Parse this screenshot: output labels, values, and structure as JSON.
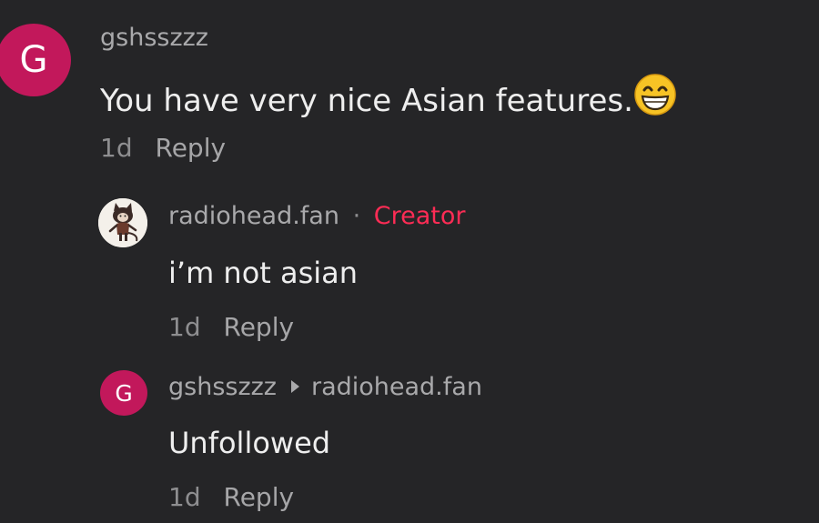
{
  "comments": [
    {
      "avatar_letter": "G",
      "username": "gshsszzz",
      "text": "You have very nice Asian features.",
      "emoji": "grinning-face-with-smiling-eyes",
      "time": "1d",
      "reply_label": "Reply"
    },
    {
      "username": "radiohead.fan",
      "separator": "·",
      "badge": "Creator",
      "text": "i’m not asian",
      "time": "1d",
      "reply_label": "Reply"
    },
    {
      "avatar_letter": "G",
      "username": "gshsszzz",
      "reply_to": "radiohead.fan",
      "text": "Unfollowed",
      "time": "1d",
      "reply_label": "Reply"
    }
  ],
  "colors": {
    "background": "#252527",
    "avatar_pink": "#c2185b",
    "creator_red": "#fe2c55"
  }
}
